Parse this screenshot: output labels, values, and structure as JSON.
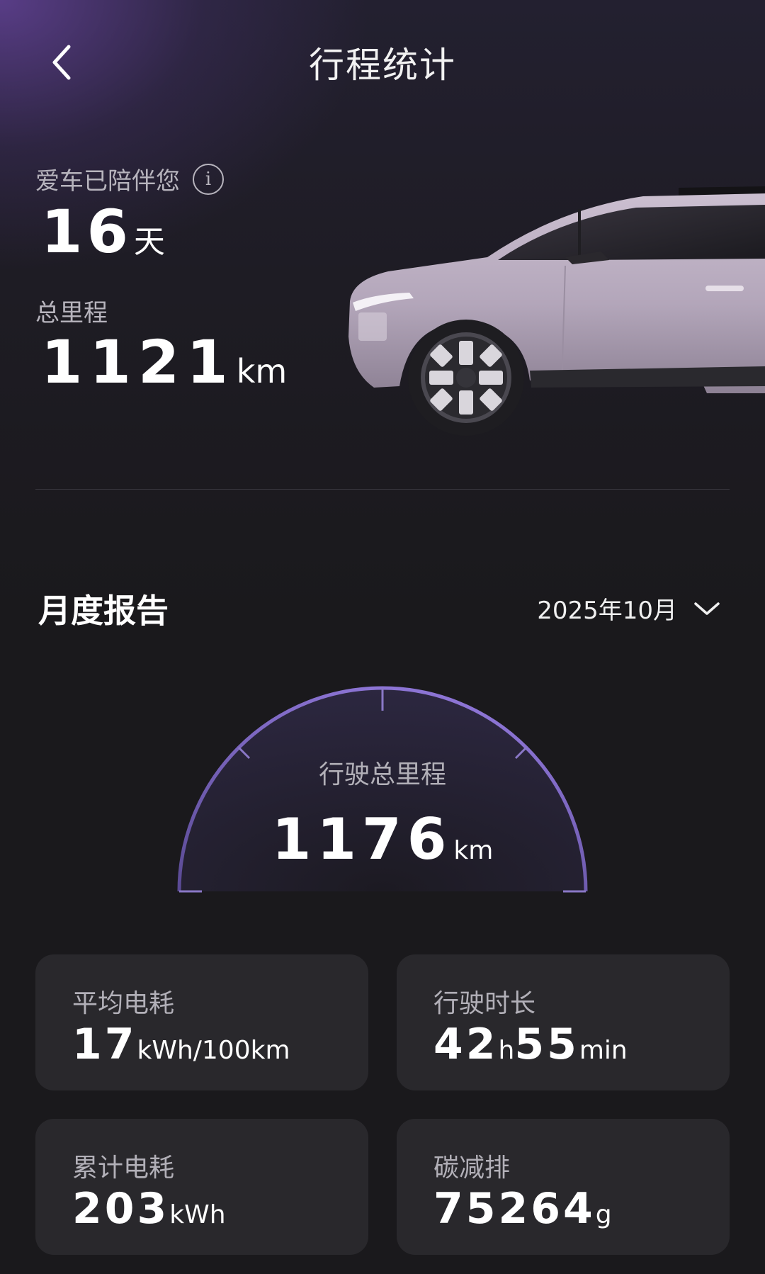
{
  "header": {
    "title": "行程统计"
  },
  "summary": {
    "companion_label": "爱车已陪伴您",
    "days_value": "16",
    "days_unit": "天",
    "mileage_label": "总里程",
    "mileage_value": "1121",
    "mileage_unit": "km"
  },
  "monthly": {
    "title": "月度报告",
    "selected_month": "2025年10月",
    "gauge": {
      "label": "行驶总里程",
      "value": "1176",
      "unit": "km"
    },
    "stats": [
      {
        "label": "平均电耗",
        "value": "17",
        "unit": "kWh/100km"
      },
      {
        "label": "行驶时长",
        "value_h": "42",
        "unit_h": "h",
        "value_min": "55",
        "unit_min": "min"
      },
      {
        "label": "累计电耗",
        "value": "203",
        "unit": "kWh"
      },
      {
        "label": "碳减排",
        "value": "75264",
        "unit": "g"
      }
    ]
  },
  "colors": {
    "background": "#1a191c",
    "card": "#29282c",
    "accent_purple": "#7a62c2",
    "car_body": "#b9acbf"
  },
  "icons": {
    "back": "chevron-left-icon",
    "info": "info-icon",
    "dropdown": "chevron-down-icon"
  }
}
